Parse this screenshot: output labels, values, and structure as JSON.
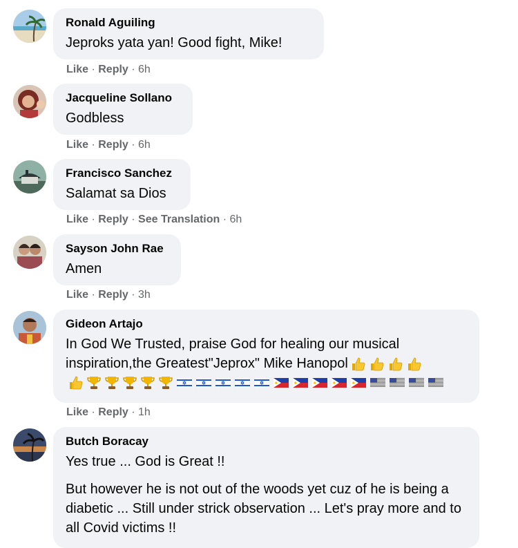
{
  "comments": [
    {
      "author": "Ronald Aguiling",
      "text": "Jeproks yata yan! Good fight, Mike!",
      "like": "Like",
      "reply": "Reply",
      "time": "6h"
    },
    {
      "author": "Jacqueline Sollano",
      "text": "Godbless",
      "like": "Like",
      "reply": "Reply",
      "time": "6h"
    },
    {
      "author": "Francisco Sanchez",
      "text": "Salamat sa Dios",
      "like": "Like",
      "reply": "Reply",
      "see_translation": "See Translation",
      "time": "6h"
    },
    {
      "author": "Sayson John Rae",
      "text": "Amen",
      "like": "Like",
      "reply": "Reply",
      "time": "3h"
    },
    {
      "author": "Gideon Artajo",
      "text_line1": "In God We Trusted, praise God for healing our musical",
      "text_line2": "inspiration,the Greatest\"Jeprox\" Mike Hanopol",
      "emojis": [
        "thumbs-up",
        "thumbs-up",
        "thumbs-up",
        "thumbs-up",
        "thumbs-up",
        "trophy",
        "trophy",
        "trophy",
        "trophy",
        "trophy",
        "israel-flag",
        "israel-flag",
        "israel-flag",
        "israel-flag",
        "israel-flag",
        "philippines-flag",
        "philippines-flag",
        "philippines-flag",
        "philippines-flag",
        "philippines-flag",
        "us-flag",
        "us-flag",
        "us-flag",
        "us-flag"
      ],
      "like": "Like",
      "reply": "Reply",
      "time": "1h"
    },
    {
      "author": "Butch Boracay",
      "paragraph1": "Yes true ... God is Great !!",
      "paragraph2": "But however he is not out of the woods yet cuz of he is being a diabetic ... Still under strick observation ... Let's pray more and to all Covid victims !!"
    }
  ],
  "separator": " · ",
  "colors": {
    "bubble": "#f0f2f5",
    "meta": "#65676b",
    "text": "#050505"
  }
}
